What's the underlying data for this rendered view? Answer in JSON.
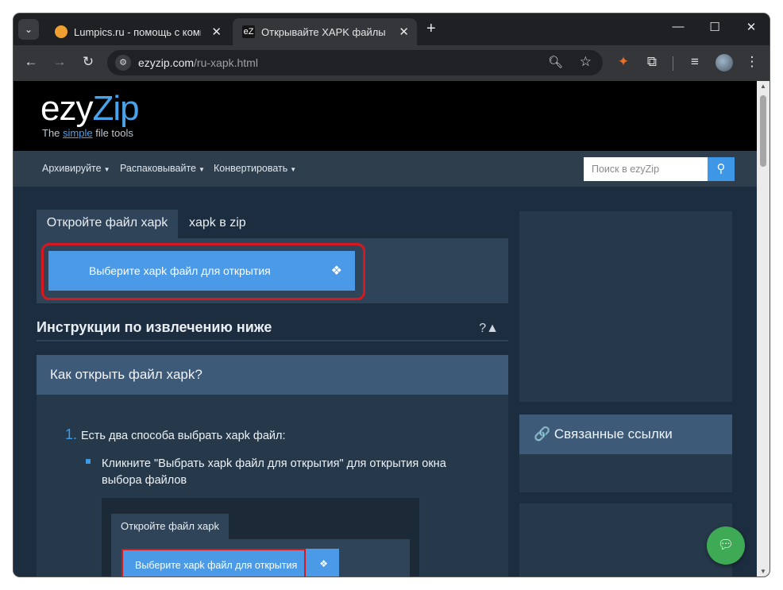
{
  "browser": {
    "tabs": [
      {
        "title": "Lumpics.ru - помощь с компь",
        "close": "✕"
      },
      {
        "title": "Открывайте XAPK файлы онла",
        "close": "✕",
        "favicon_text": "eZ"
      }
    ],
    "tab_menu_icon": "⌄",
    "new_tab": "+",
    "window_controls": {
      "minimize": "—",
      "maximize": "☐",
      "close": "✕"
    },
    "nav": {
      "back": "←",
      "forward": "→",
      "reload": "↻"
    },
    "url_host": "ezyzip.com",
    "url_path": "/ru-xapk.html"
  },
  "site": {
    "logo_main": "ezy",
    "logo_accent": "Zip",
    "tagline_pre": "The ",
    "tagline_accent": "simple",
    "tagline_post": " file tools",
    "nav": [
      {
        "label": "Архивируйте"
      },
      {
        "label": "Распаковывайте"
      },
      {
        "label": "Конвертировать"
      }
    ],
    "search_placeholder": "Поиск в ezyZip"
  },
  "main": {
    "tab_active": "Откройте файл xapk",
    "tab_other": "xapk в zip",
    "upload_label": "Выберите xapk файл для открытия",
    "instructions_title": "Инструкции по извлечению ниже",
    "instructions_toggle": "?▲",
    "howto_title": "Как открыть файл xapk?",
    "step_number": "1.",
    "step_text": "Есть два способа выбрать xapk файл:",
    "bullet_text": "Кликните \"Выбрать xapk файл для открытия\" для открытия окна выбора файлов",
    "screenshot_tab": "Откройте файл xapk",
    "screenshot_button": "Выберите xapk файл для открытия"
  },
  "sidebar": {
    "related_title": "🔗 Связанные ссылки"
  },
  "colors": {
    "accent": "#4a9ae8",
    "highlight": "#d7191f",
    "chat": "#3faa55"
  }
}
